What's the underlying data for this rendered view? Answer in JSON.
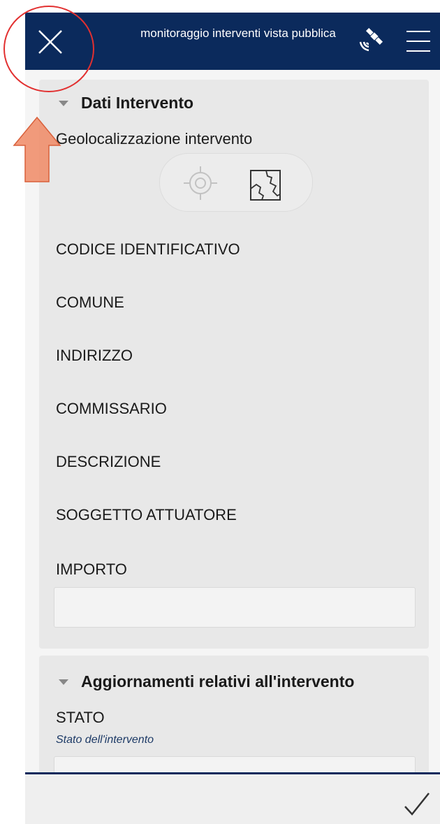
{
  "header": {
    "title": "monitoraggio interventi vista pubblica",
    "close_icon": "close-icon",
    "satellite_icon": "satellite-icon",
    "menu_icon": "hamburger-menu-icon",
    "bg_color": "#0b2a5c"
  },
  "section1": {
    "title": "Dati Intervento",
    "geolocation_label": "Geolocalizzazione intervento",
    "geo_tools": [
      "locate-target-icon",
      "map-region-icon"
    ],
    "fields": [
      "CODICE IDENTIFICATIVO",
      "COMUNE",
      "INDIRIZZO",
      "COMMISSARIO",
      "DESCRIZIONE",
      "SOGGETTO ATTUATORE",
      "IMPORTO"
    ],
    "importo_value": ""
  },
  "section2": {
    "title": "Aggiornamenti relativi all'intervento",
    "stato_label": "STATO",
    "stato_hint": "Stato dell'intervento",
    "stato_value": ""
  },
  "footer": {
    "submit_icon": "checkmark-icon"
  },
  "annotation": {
    "circle_color": "#e23030",
    "arrow_color": "#f08a65"
  }
}
